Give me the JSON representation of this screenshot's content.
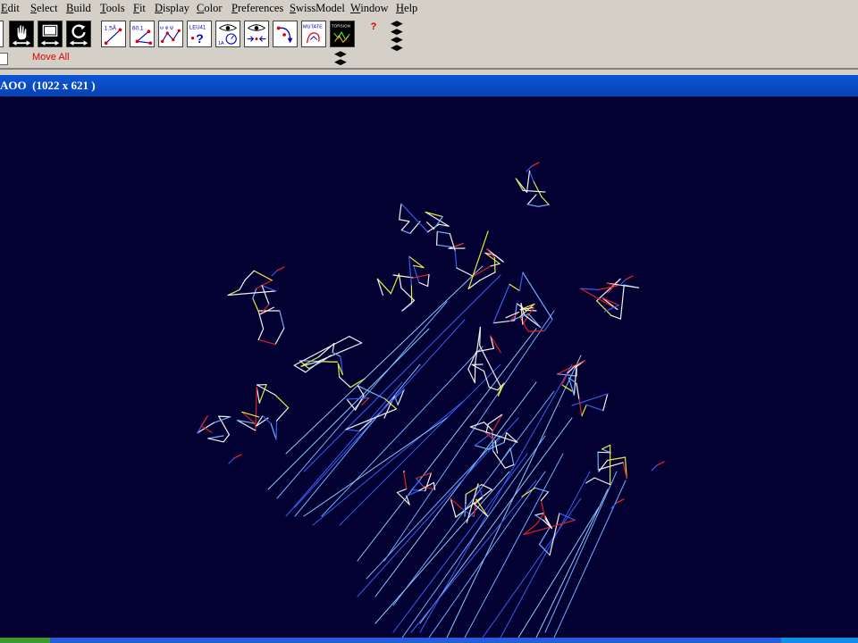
{
  "menu": {
    "items": [
      {
        "label": "Edit",
        "accel": "E",
        "rest": "dit"
      },
      {
        "label": "Select",
        "accel": "S",
        "rest": "elect"
      },
      {
        "label": "Build",
        "accel": "B",
        "rest": "uild"
      },
      {
        "label": "Tools",
        "accel": "T",
        "rest": "ools"
      },
      {
        "label": "Fit",
        "accel": "F",
        "rest": "it"
      },
      {
        "label": "Display",
        "accel": "D",
        "rest": "isplay"
      },
      {
        "label": "Color",
        "accel": "C",
        "rest": "olor"
      },
      {
        "label": "Preferences",
        "accel": "P",
        "rest": "references"
      },
      {
        "label": "SwissModel",
        "accel": "S",
        "rest": "wissModel"
      },
      {
        "label": "Window",
        "accel": "W",
        "rest": "indow"
      },
      {
        "label": "Help",
        "accel": "H",
        "rest": "elp"
      }
    ]
  },
  "toolbar": {
    "tools": [
      {
        "name": "move-all-hand",
        "label": ""
      },
      {
        "name": "move-screen",
        "label": ""
      },
      {
        "name": "rotate",
        "label": ""
      },
      {
        "name": "measure-distance",
        "label": "1.5Å"
      },
      {
        "name": "measure-angle",
        "label": "60.1"
      },
      {
        "name": "measure-torsion",
        "label": "ω φ ψ"
      },
      {
        "name": "residue-info",
        "label": "LEU41"
      },
      {
        "name": "center-atom",
        "label": ""
      },
      {
        "name": "fit-view",
        "label": ""
      },
      {
        "name": "fix-rotate",
        "label": ""
      },
      {
        "name": "mutate",
        "label": "MUTATE"
      },
      {
        "name": "torsion",
        "label": "TORSION"
      }
    ],
    "help_label": "?",
    "status_text": "Move All"
  },
  "window": {
    "title": "AOO  (1022 x 621 )"
  },
  "colors": {
    "menubar_bg": "#d4d0c8",
    "titlebar_bg": "#0a4bc4",
    "viewer_bg": "#020131",
    "bond_white": "#f2f2f2",
    "bond_blue": "#3a5cf0",
    "bond_lightblue": "#6fb0ff",
    "bond_red": "#e02020",
    "bond_yellow": "#e8e840",
    "status_red": "#e00000"
  }
}
